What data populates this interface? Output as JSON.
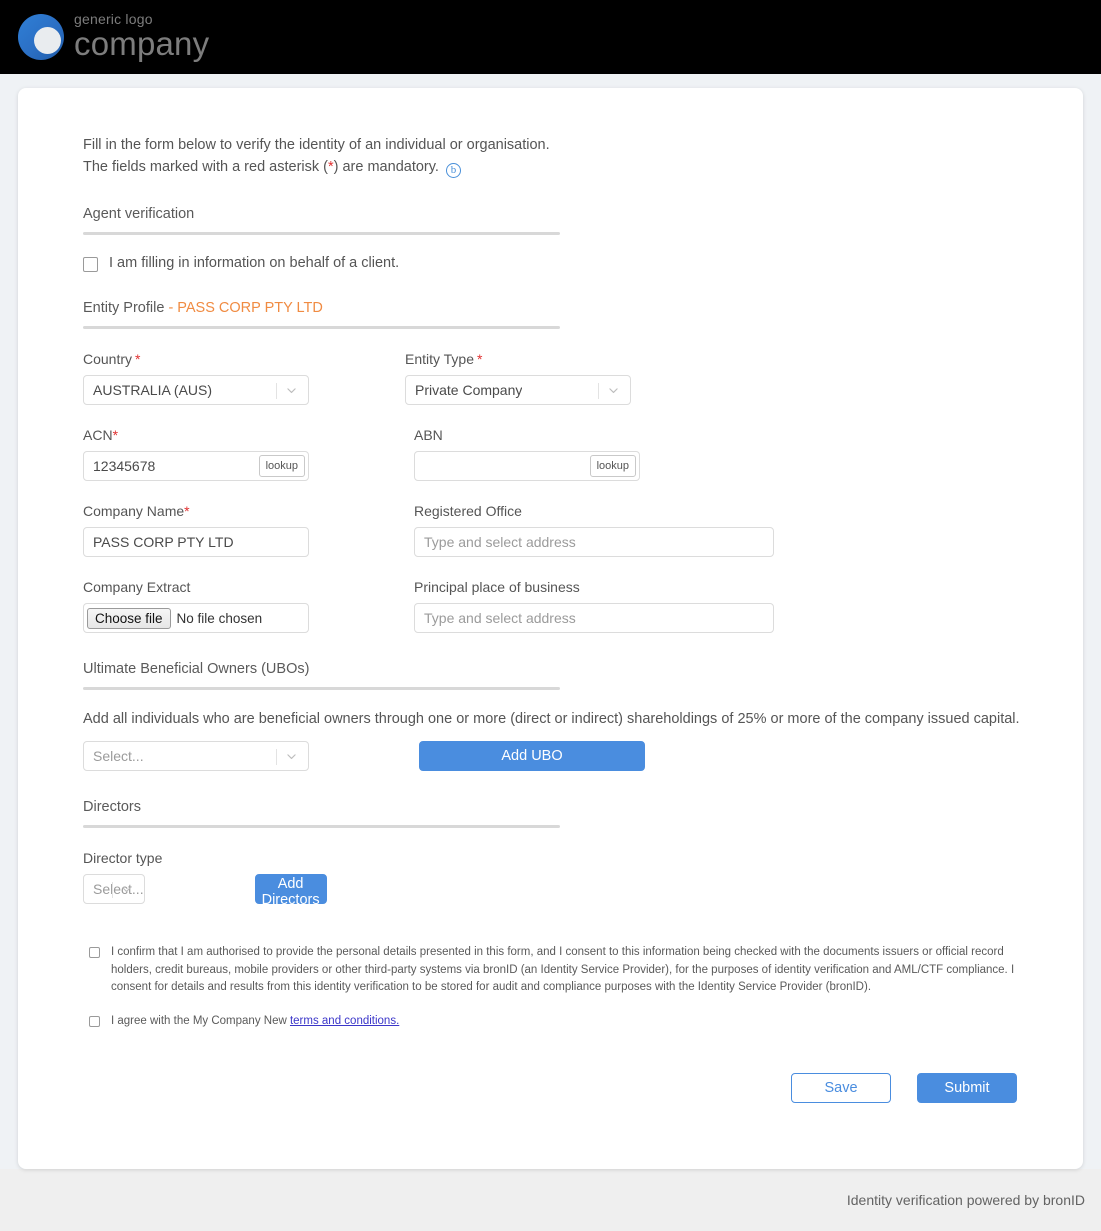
{
  "header": {
    "logo_top": "generic logo",
    "logo_bottom": "company",
    "logo_icon": "circle-logo-icon"
  },
  "intro": {
    "line1": "Fill in the form below to verify the identity of an individual or organisation.",
    "line2_pre": "The fields marked with a red asterisk (",
    "line2_star": "*",
    "line2_post": ") are mandatory.",
    "badge": "b"
  },
  "agent_section": {
    "title": "Agent verification",
    "checkbox_label": "I am filling in information on behalf of a client.",
    "checked": false
  },
  "entity_section": {
    "title": "Entity Profile",
    "accent": "- PASS CORP PTY LTD",
    "fields": {
      "country": {
        "label": "Country",
        "required": true,
        "value": "AUSTRALIA (AUS)"
      },
      "entity_type": {
        "label": "Entity Type",
        "required": true,
        "value": "Private Company"
      },
      "acn": {
        "label": "ACN",
        "required": true,
        "value": "12345678",
        "placeholder": "",
        "lookup": "lookup"
      },
      "abn": {
        "label": "ABN",
        "required": false,
        "value": "",
        "placeholder": "",
        "lookup": "lookup"
      },
      "company_name": {
        "label": "Company Name",
        "required": true,
        "value": "PASS CORP PTY LTD",
        "placeholder": ""
      },
      "registered_office": {
        "label": "Registered Office",
        "required": false,
        "value": "",
        "placeholder": "Type and select address"
      },
      "company_extract": {
        "label": "Company Extract",
        "button": "Choose file",
        "status": "No file chosen"
      },
      "principal_place": {
        "label": "Principal place of business",
        "value": "",
        "placeholder": "Type and select address"
      }
    }
  },
  "ubo_section": {
    "title": "Ultimate Beneficial Owners (UBOs)",
    "helper": "Add all individuals who are beneficial owners through one or more (direct or indirect) shareholdings of 25% or more of the company issued capital.",
    "select_placeholder": "Select...",
    "add_button": "Add UBO"
  },
  "directors_section": {
    "title": "Directors",
    "field_label": "Director type",
    "select_placeholder": "Select...",
    "add_button": "Add Directors"
  },
  "consent": {
    "item1": "I confirm that I am authorised to provide the personal details presented in this form, and I consent to this information being checked with the documents issuers or official record holders, credit bureaus, mobile providers or other third-party systems via bronID (an Identity Service Provider), for the purposes of identity verification and AML/CTF compliance. I consent for details and results from this identity verification to be stored for audit and compliance purposes with the Identity Service Provider (bronID).",
    "item1_checked": false,
    "item2_pre": "I agree with the My Company New ",
    "item2_link": "terms and conditions.",
    "item2_checked": false
  },
  "actions": {
    "save": "Save",
    "submit": "Submit"
  },
  "footer": {
    "text": "Identity verification powered by bronID"
  },
  "colors": {
    "accent_blue": "#4a8ddf",
    "orange": "#f08b42",
    "required_red": "#e03131",
    "link": "#3b36c9",
    "page_bg": "#eff2f5",
    "header_bg": "#000000",
    "footer_bg": "#efefef"
  }
}
